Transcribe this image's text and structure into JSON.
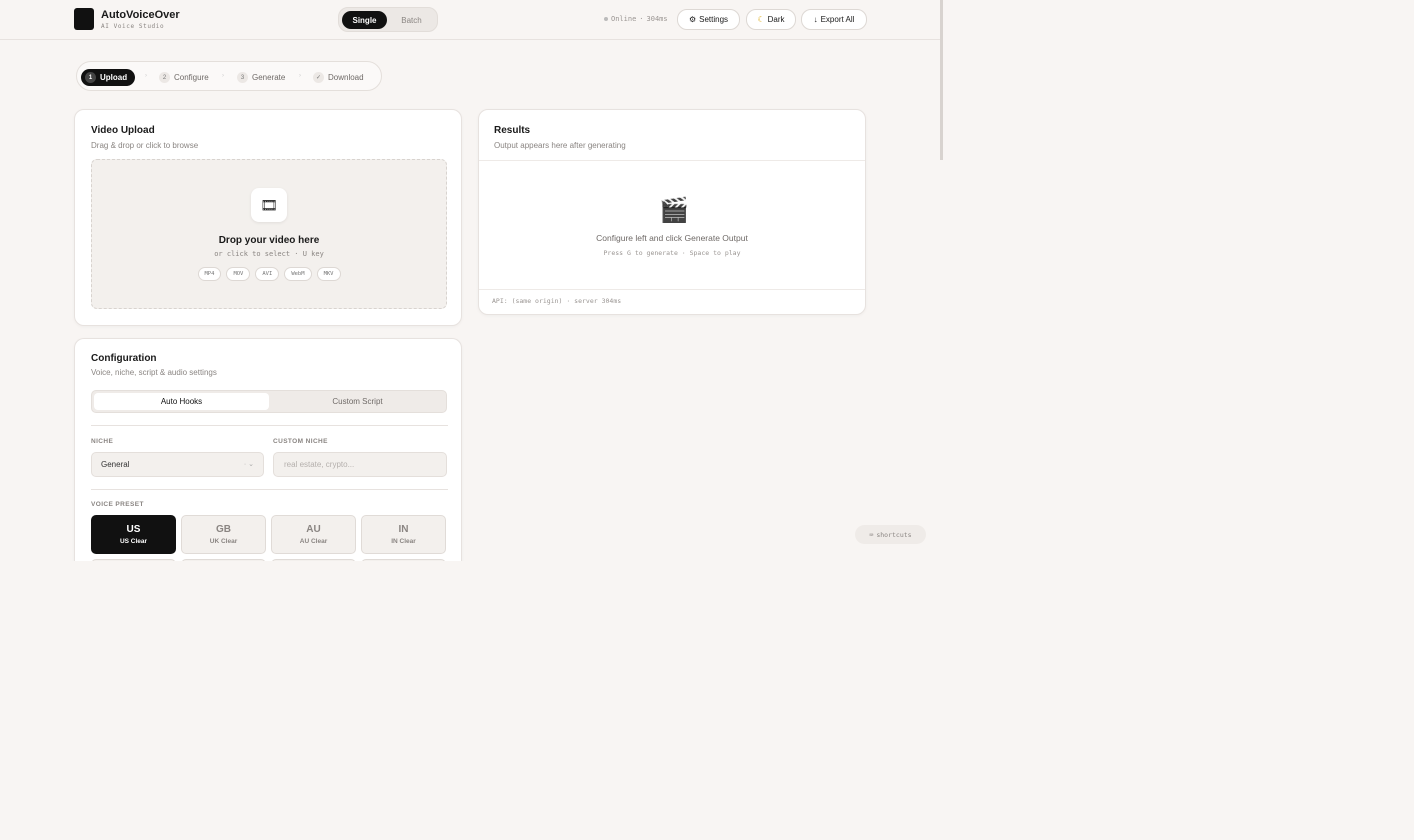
{
  "header": {
    "app_name": "AutoVoiceOver",
    "app_subtitle": "AI Voice Studio",
    "modes": {
      "single": "Single",
      "batch": "Batch",
      "selected": "Single"
    },
    "status": {
      "label": "Online",
      "latency": "304ms"
    },
    "settings_label": "Settings",
    "theme_label": "Dark",
    "export_label": "Export All"
  },
  "steps": [
    {
      "num": "1",
      "label": "Upload",
      "active": true
    },
    {
      "num": "2",
      "label": "Configure"
    },
    {
      "num": "3",
      "label": "Generate"
    },
    {
      "num": "✓",
      "label": "Download"
    }
  ],
  "upload": {
    "title": "Video Upload",
    "subtitle": "Drag & drop or click to browse",
    "drop_title": "Drop your video here",
    "drop_sub_prefix": "or click to select ·",
    "drop_key": "U",
    "drop_sub_suffix": "key",
    "formats": [
      "MP4",
      "MOV",
      "AVI",
      "WebM",
      "MKV"
    ]
  },
  "results": {
    "title": "Results",
    "subtitle": "Output appears here after generating",
    "empty_msg": "Configure left and click Generate Output",
    "hint": "Press G to generate · Space to play",
    "footer": "API: (same origin) · server 304ms"
  },
  "config": {
    "title": "Configuration",
    "subtitle": "Voice, niche, script & audio settings",
    "tabs": {
      "auto": "Auto Hooks",
      "custom": "Custom Script",
      "selected": "Auto Hooks"
    },
    "niche_label": "NICHE",
    "niche_value": "General",
    "custom_niche_label": "CUSTOM NICHE",
    "custom_niche_placeholder": "real estate, crypto...",
    "voice_label": "VOICE PRESET",
    "voices": [
      {
        "code": "US",
        "name": "US Clear",
        "selected": true
      },
      {
        "code": "GB",
        "name": "UK Clear"
      },
      {
        "code": "AU",
        "name": "AU Clear"
      },
      {
        "code": "IN",
        "name": "IN Clear"
      }
    ]
  },
  "shortcuts_label": "shortcuts",
  "colors": {
    "accent": "#111111",
    "background": "#f8f5f3",
    "card": "#ffffff"
  }
}
